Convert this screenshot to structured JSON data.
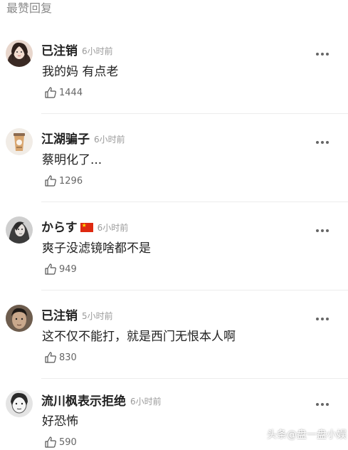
{
  "section": {
    "title": "最赞回复"
  },
  "comments": [
    {
      "username": "已注销",
      "time": "6小时前",
      "content": "我的妈 有点老",
      "likes": "1444",
      "avatar": "woman-long-hair-avatar"
    },
    {
      "username": "江湖骗子",
      "time": "6小时前",
      "content": "蔡明化了...",
      "likes": "1296",
      "avatar": "cup-avatar"
    },
    {
      "username": "からす",
      "time": "6小时前",
      "content": "爽子没滤镜啥都不是",
      "likes": "949",
      "avatar": "woman-portrait-avatar",
      "flag": "china-flag-icon"
    },
    {
      "username": "已注销",
      "time": "5小时前",
      "content": "这不仅不能打，就是西门无恨本人啊",
      "likes": "830",
      "avatar": "dark-face-avatar"
    },
    {
      "username": "流川枫表示拒绝",
      "time": "6小时前",
      "content": "好恐怖",
      "likes": "590",
      "avatar": "sketch-face-avatar"
    }
  ],
  "watermark": "头条@盘一盘小娱",
  "colors": {
    "text": "#222222",
    "secondary": "#9a9a9a",
    "divider": "#ececec"
  }
}
